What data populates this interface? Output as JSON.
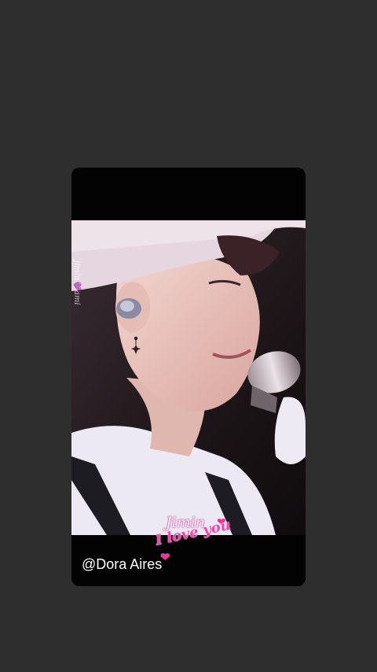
{
  "story": {
    "watermark": "jimin💜ami",
    "sticker": {
      "line1": "Jimin",
      "line2": "I love you",
      "heart_icon": "heart-icon"
    },
    "mention": "@Dora Aires"
  },
  "colors": {
    "background": "#2f2e2e",
    "card": "#030303",
    "sticker_pink": "#ff3fb0"
  }
}
